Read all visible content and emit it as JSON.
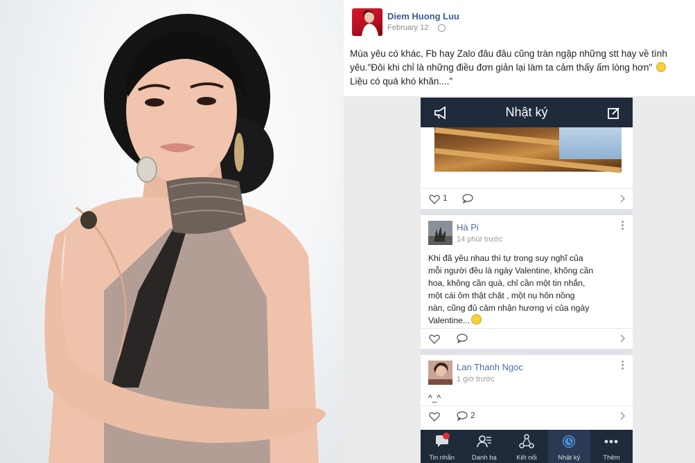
{
  "post": {
    "author": "Diem Huong Luu",
    "date": "February 12",
    "privacy_icon": "globe-icon",
    "text": "Mùa yêu có khác, Fb hay Zalo đâu đâu cũng tràn ngập những stt hay về tình yêu.\"Đôi khi chỉ là những điều đơn giản lại làm ta cảm thấy ấm lòng hơn\"",
    "text_end": "Liệu có quá khó khăn....\""
  },
  "phone": {
    "title": "Nhật ký",
    "left_icon": "megaphone-icon",
    "right_icon": "compose-icon",
    "card1": {
      "likes": "1"
    },
    "entries": [
      {
        "name": "Hà Pi",
        "time": "14 phút trước",
        "text": "Khi đã yêu nhau thì tự trong suy nghĩ của\nmỗi người đều là ngày Valentine, không cần\nhoa, không cần quà, chỉ cần một tin nhắn,\nmột cái ôm thật chặt , một nụ hôn nồng\nnàn, cũng đủ cảm nhận hương vị của ngày\nValentine..."
      },
      {
        "name": "Lan Thanh Ngoc",
        "time": "1 giờ trước",
        "text": "^_^",
        "comments": "2"
      }
    ],
    "nav": [
      {
        "label": "Tin nhắn",
        "icon": "chat-icon"
      },
      {
        "label": "Danh bạ",
        "icon": "contacts-icon"
      },
      {
        "label": "Kết nối",
        "icon": "connect-icon"
      },
      {
        "label": "Nhật ký",
        "icon": "clock-icon"
      },
      {
        "label": "Thêm",
        "icon": "more-icon"
      }
    ],
    "colors": {
      "bar": "#1f2a3b",
      "accent": "#4a90d9",
      "link": "#3b5998"
    }
  }
}
